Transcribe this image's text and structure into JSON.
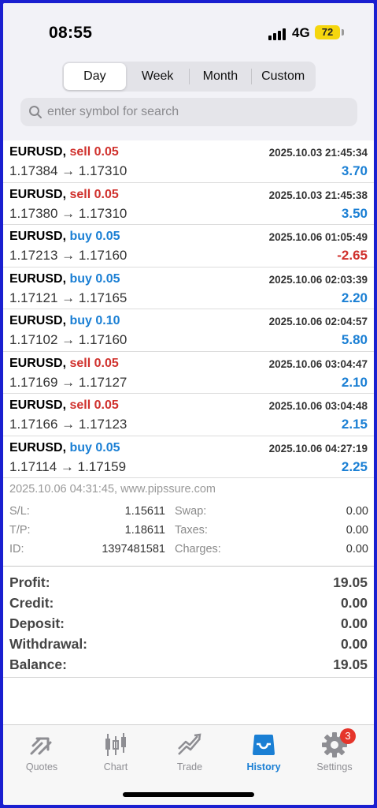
{
  "status_bar": {
    "time": "08:55",
    "network": "4G",
    "battery": "72"
  },
  "segments": [
    {
      "label": "Day",
      "active": true
    },
    {
      "label": "Week",
      "active": false
    },
    {
      "label": "Month",
      "active": false
    },
    {
      "label": "Custom",
      "active": false
    }
  ],
  "search": {
    "placeholder": "enter symbol for search"
  },
  "deals": [
    {
      "symbol": "EURUSD,",
      "side": "sell 0.05",
      "type": "sell",
      "datetime": "2025.10.03 21:45:34",
      "prices": "1.17384 → 1.17310",
      "profit": "3.70",
      "sign": "pos"
    },
    {
      "symbol": "EURUSD,",
      "side": "sell 0.05",
      "type": "sell",
      "datetime": "2025.10.03 21:45:38",
      "prices": "1.17380 → 1.17310",
      "profit": "3.50",
      "sign": "pos"
    },
    {
      "symbol": "EURUSD,",
      "side": "buy 0.05",
      "type": "buy",
      "datetime": "2025.10.06 01:05:49",
      "prices": "1.17213 → 1.17160",
      "profit": "-2.65",
      "sign": "neg"
    },
    {
      "symbol": "EURUSD,",
      "side": "buy 0.05",
      "type": "buy",
      "datetime": "2025.10.06 02:03:39",
      "prices": "1.17121 → 1.17165",
      "profit": "2.20",
      "sign": "pos"
    },
    {
      "symbol": "EURUSD,",
      "side": "buy 0.10",
      "type": "buy",
      "datetime": "2025.10.06 02:04:57",
      "prices": "1.17102 → 1.17160",
      "profit": "5.80",
      "sign": "pos"
    },
    {
      "symbol": "EURUSD,",
      "side": "sell 0.05",
      "type": "sell",
      "datetime": "2025.10.06 03:04:47",
      "prices": "1.17169 → 1.17127",
      "profit": "2.10",
      "sign": "pos"
    },
    {
      "symbol": "EURUSD,",
      "side": "sell 0.05",
      "type": "sell",
      "datetime": "2025.10.06 03:04:48",
      "prices": "1.17166 → 1.17123",
      "profit": "2.15",
      "sign": "pos"
    },
    {
      "symbol": "EURUSD,",
      "side": "buy 0.05",
      "type": "buy",
      "datetime": "2025.10.06 04:27:19",
      "prices": "1.17114 → 1.17159",
      "profit": "2.25",
      "sign": "pos"
    }
  ],
  "details": {
    "header": "2025.10.06 04:31:45, www.pipssure.com",
    "lines": [
      {
        "k1": "S/L:",
        "v1": "1.15611",
        "k2": "Swap:",
        "v2": "0.00"
      },
      {
        "k1": "T/P:",
        "v1": "1.18611",
        "k2": "Taxes:",
        "v2": "0.00"
      },
      {
        "k1": "ID:",
        "v1": "1397481581",
        "k2": "Charges:",
        "v2": "0.00"
      }
    ]
  },
  "summary": [
    {
      "label": "Profit:",
      "value": "19.05"
    },
    {
      "label": "Credit:",
      "value": "0.00"
    },
    {
      "label": "Deposit:",
      "value": "0.00"
    },
    {
      "label": "Withdrawal:",
      "value": "0.00"
    },
    {
      "label": "Balance:",
      "value": "19.05"
    }
  ],
  "tabs": [
    {
      "label": "Quotes",
      "icon": "quotes-icon"
    },
    {
      "label": "Chart",
      "icon": "candlestick-icon"
    },
    {
      "label": "Trade",
      "icon": "trade-icon"
    },
    {
      "label": "History",
      "icon": "inbox-icon",
      "active": true
    },
    {
      "label": "Settings",
      "icon": "gear-icon",
      "badge": "3"
    }
  ],
  "colors": {
    "sell": "#d0312d",
    "buy": "#1a7fd4",
    "profit_neg": "#d0312d",
    "profit_pos": "#1a7fd4",
    "active_tab": "#1a7fd4",
    "battery": "#f5d60e",
    "border": "#1a1fd0"
  }
}
